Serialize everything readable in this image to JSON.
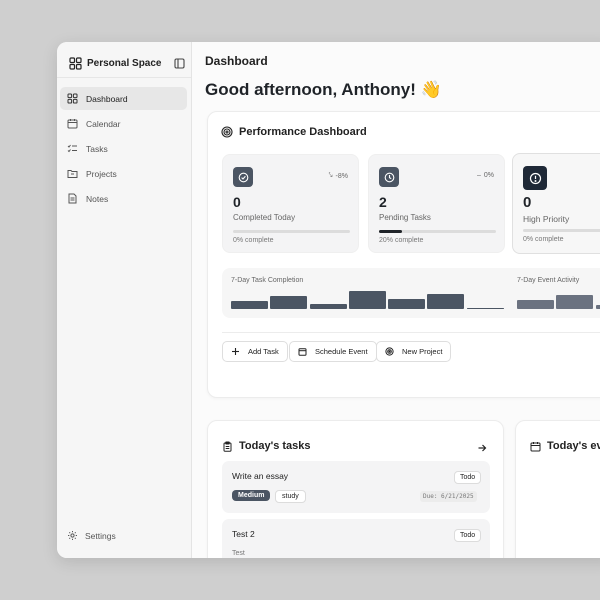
{
  "sidebar": {
    "workspace_name": "Personal Space",
    "items": [
      {
        "label": "Dashboard",
        "icon": "grid-icon",
        "active": true
      },
      {
        "label": "Calendar",
        "icon": "calendar-icon"
      },
      {
        "label": "Tasks",
        "icon": "checklist-icon"
      },
      {
        "label": "Projects",
        "icon": "folder-icon"
      },
      {
        "label": "Notes",
        "icon": "note-icon"
      }
    ],
    "settings_label": "Settings"
  },
  "header": {
    "page_title": "Dashboard",
    "greeting": "Good afternoon, Anthony! 👋"
  },
  "performance": {
    "title": "Performance Dashboard",
    "stats": [
      {
        "value": "0",
        "label": "Completed Today",
        "trend": "-8%",
        "progress": "0% complete",
        "fill": 0
      },
      {
        "value": "2",
        "label": "Pending Tasks",
        "trend": "0%",
        "progress": "20% complete",
        "fill": 20
      },
      {
        "value": "0",
        "label": "High Priority",
        "progress": "0% complete",
        "fill": 0
      }
    ],
    "chart_task_label": "7-Day Task Completion",
    "chart_event_label": "7-Day Event Activity",
    "actions": [
      "Add Task",
      "Schedule Event",
      "New Project"
    ]
  },
  "tasks": {
    "title": "Today's tasks",
    "items": [
      {
        "title": "Write an essay",
        "status": "Todo",
        "priority": "Medium",
        "category": "study",
        "due": "Due: 6/21/2025"
      },
      {
        "title": "Test 2",
        "status": "Todo",
        "description": "Test"
      }
    ]
  },
  "events": {
    "title": "Today's eve"
  },
  "colors": {
    "accent": "#4b5563",
    "dark": "#1f2937",
    "background": "#cfcfcf"
  }
}
